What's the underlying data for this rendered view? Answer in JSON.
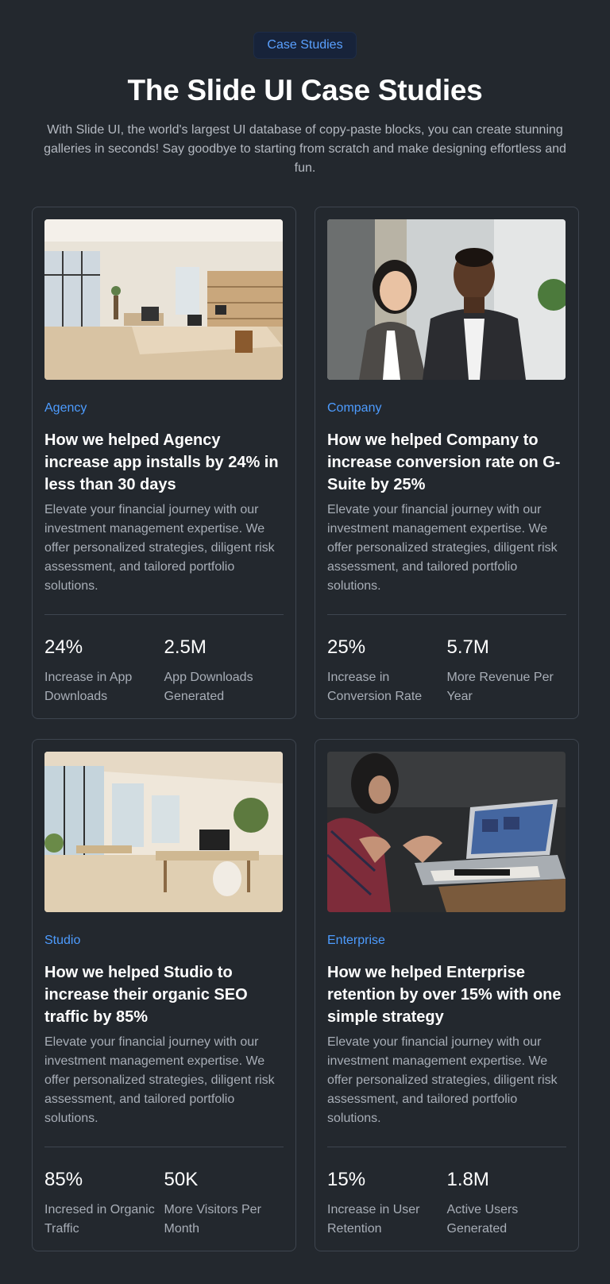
{
  "header": {
    "badge": "Case Studies",
    "title": "The Slide UI Case Studies",
    "subtitle": "With Slide UI, the world's largest UI database of copy-paste blocks, you can create stunning galleries in seconds! Say goodbye to starting from scratch and make designing effortless and fun."
  },
  "cards": [
    {
      "tag": "Agency",
      "title": "How we helped Agency increase app installs by 24% in less than 30 days",
      "description": "Elevate your financial journey with our investment management expertise. We offer personalized strategies, diligent risk assessment, and tailored portfolio solutions.",
      "stats": [
        {
          "value": "24%",
          "label": "Increase in App Downloads"
        },
        {
          "value": "2.5M",
          "label": "App Downloads Generated"
        }
      ]
    },
    {
      "tag": "Company",
      "title": "How we helped Company to increase conversion rate on G-Suite by 25%",
      "description": "Elevate your financial journey with our investment management expertise. We offer personalized strategies, diligent risk assessment, and tailored portfolio solutions.",
      "stats": [
        {
          "value": "25%",
          "label": "Increase in Conversion Rate"
        },
        {
          "value": "5.7M",
          "label": "More Revenue Per Year"
        }
      ]
    },
    {
      "tag": "Studio",
      "title": "How we helped Studio to increase their organic SEO traffic by 85%",
      "description": "Elevate your financial journey with our investment management expertise. We offer personalized strategies, diligent risk assessment, and tailored portfolio solutions.",
      "stats": [
        {
          "value": "85%",
          "label": "Incresed in Organic Traffic"
        },
        {
          "value": "50K",
          "label": "More Visitors Per Month"
        }
      ]
    },
    {
      "tag": "Enterprise",
      "title": "How we helped Enterprise retention by over 15% with one simple strategy",
      "description": "Elevate your financial journey with our investment management expertise. We offer personalized strategies, diligent risk assessment, and tailored portfolio solutions.",
      "stats": [
        {
          "value": "15%",
          "label": "Increase in User Retention"
        },
        {
          "value": "1.8M",
          "label": "Active Users Generated"
        }
      ]
    }
  ],
  "colors": {
    "background": "#23282e",
    "accent": "#4d9cff",
    "card_border": "#3e454f"
  }
}
